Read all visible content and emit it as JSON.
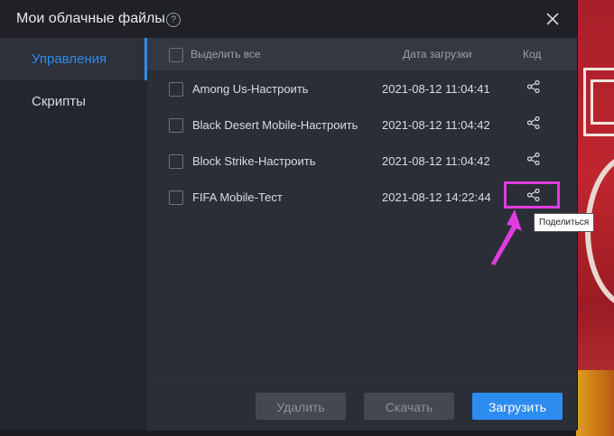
{
  "window": {
    "title": "Мои облачные файлы"
  },
  "sidebar": {
    "items": [
      {
        "label": "Управления",
        "active": true
      },
      {
        "label": "Скрипты",
        "active": false
      }
    ]
  },
  "list": {
    "select_all_label": "Выделить все",
    "date_header": "Дата загрузки",
    "code_header": "Код",
    "rows": [
      {
        "name": "Among Us-Настроить",
        "date": "2021-08-12 11:04:41"
      },
      {
        "name": "Black Desert Mobile-Настроить",
        "date": "2021-08-12 11:04:42"
      },
      {
        "name": "Block Strike-Настроить",
        "date": "2021-08-12 11:04:42"
      },
      {
        "name": "FIFA Mobile-Тест",
        "date": "2021-08-12 14:22:44"
      }
    ]
  },
  "footer": {
    "delete_label": "Удалить",
    "download_label": "Скачать",
    "upload_label": "Загрузить"
  },
  "tooltip": {
    "text": "Поделиться"
  },
  "colors": {
    "accent": "#2d8cf0",
    "highlight": "#e23be0"
  },
  "icons": {
    "help": "?"
  }
}
